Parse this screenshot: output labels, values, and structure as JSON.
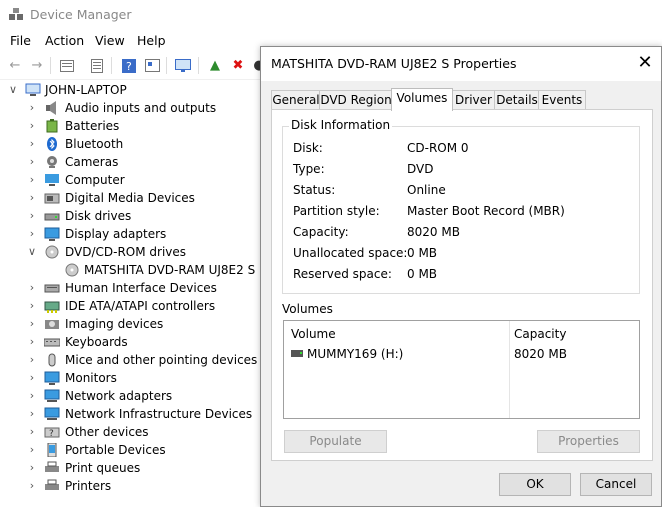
{
  "window": {
    "title": "Device Manager"
  },
  "menu": [
    "File",
    "Action",
    "View",
    "Help"
  ],
  "toolbar": {
    "icons": [
      "back-icon",
      "forward-icon",
      "properties-icon",
      "show-hidden-icon",
      "help-icon",
      "action-icon",
      "scan-icon",
      "update-driver-icon",
      "uninstall-icon",
      "disable-icon"
    ]
  },
  "tree": {
    "root": "JOHN-LAPTOP",
    "items": [
      {
        "label": "Audio inputs and outputs"
      },
      {
        "label": "Batteries"
      },
      {
        "label": "Bluetooth"
      },
      {
        "label": "Cameras"
      },
      {
        "label": "Computer"
      },
      {
        "label": "Digital Media Devices"
      },
      {
        "label": "Disk drives"
      },
      {
        "label": "Display adapters"
      },
      {
        "label": "DVD/CD-ROM drives"
      },
      {
        "label": "MATSHITA DVD-RAM UJ8E2 S"
      },
      {
        "label": "Human Interface Devices"
      },
      {
        "label": "IDE ATA/ATAPI controllers"
      },
      {
        "label": "Imaging devices"
      },
      {
        "label": "Keyboards"
      },
      {
        "label": "Mice and other pointing devices"
      },
      {
        "label": "Monitors"
      },
      {
        "label": "Network adapters"
      },
      {
        "label": "Network Infrastructure Devices"
      },
      {
        "label": "Other devices"
      },
      {
        "label": "Portable Devices"
      },
      {
        "label": "Print queues"
      },
      {
        "label": "Printers"
      }
    ]
  },
  "dialog": {
    "title": "MATSHITA DVD-RAM UJ8E2 S Properties",
    "tabs": [
      "General",
      "DVD Region",
      "Volumes",
      "Driver",
      "Details",
      "Events"
    ],
    "active_tab": "Volumes",
    "disk_info": {
      "group_title": "Disk Information",
      "rows": [
        {
          "label": "Disk:",
          "value": "CD-ROM 0"
        },
        {
          "label": "Type:",
          "value": "DVD"
        },
        {
          "label": "Status:",
          "value": "Online"
        },
        {
          "label": "Partition style:",
          "value": "Master Boot Record (MBR)"
        },
        {
          "label": "Capacity:",
          "value": "8020 MB"
        },
        {
          "label": "Unallocated space:",
          "value": "0 MB"
        },
        {
          "label": "Reserved space:",
          "value": "0 MB"
        }
      ]
    },
    "volumes": {
      "title": "Volumes",
      "columns": [
        "Volume",
        "Capacity"
      ],
      "rows": [
        {
          "volume": "MUMMY169 (H:)",
          "capacity": "8020 MB"
        }
      ]
    },
    "buttons": {
      "populate": "Populate",
      "properties": "Properties",
      "ok": "OK",
      "cancel": "Cancel"
    }
  }
}
